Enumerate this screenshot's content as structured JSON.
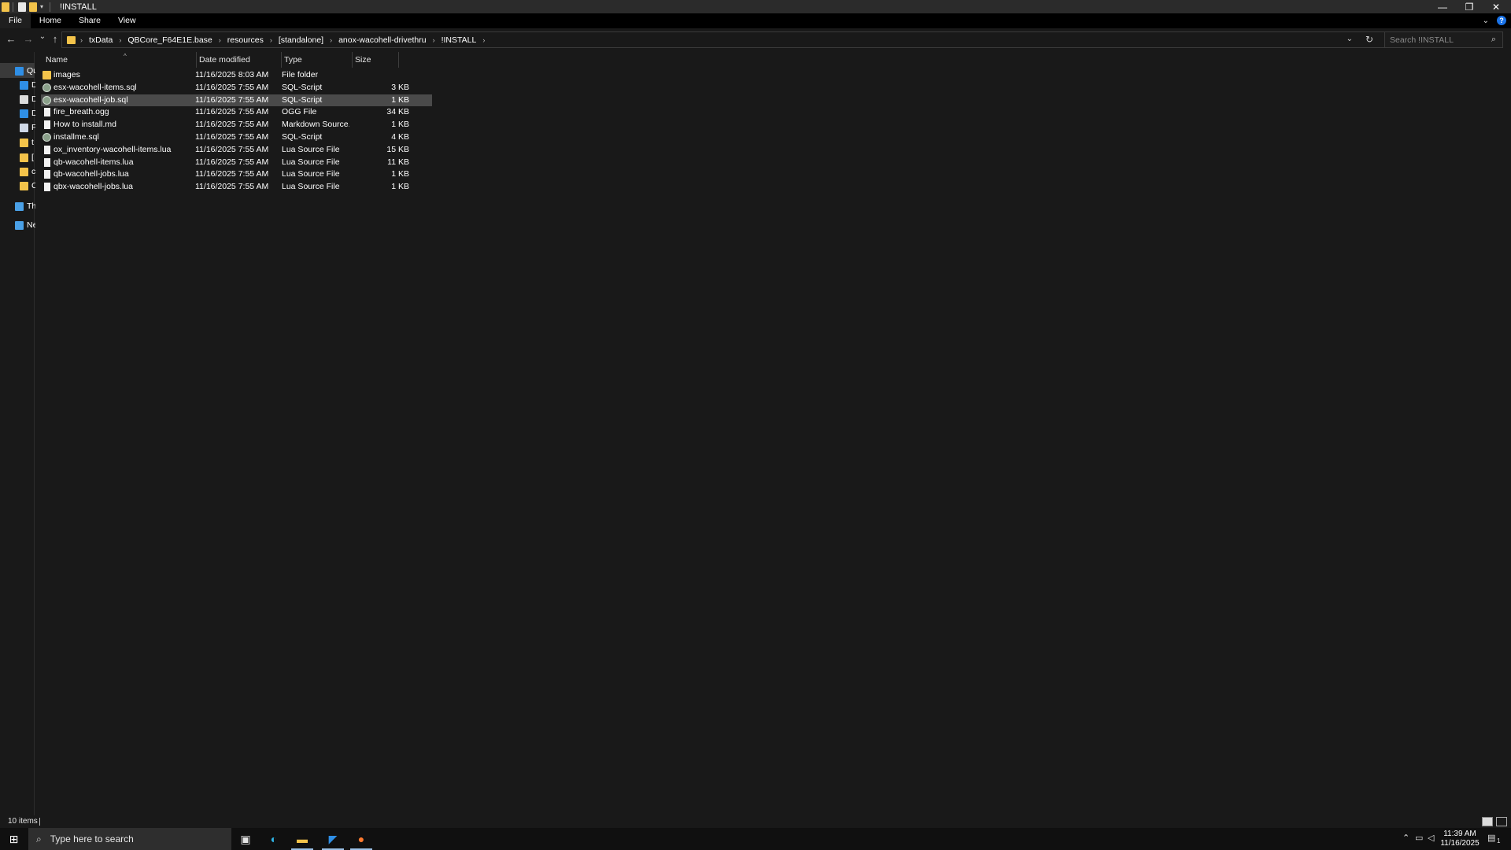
{
  "window": {
    "title": "!INSTALL",
    "controls": {
      "minimize": "—",
      "restore": "❐",
      "close": "✕"
    }
  },
  "ribbon": {
    "tabs": [
      {
        "label": "File"
      },
      {
        "label": "Home"
      },
      {
        "label": "Share"
      },
      {
        "label": "View"
      }
    ]
  },
  "nav_buttons": {
    "back": "←",
    "forward": "→",
    "recent": "⌄",
    "up": "↑"
  },
  "address": {
    "crumbs": [
      {
        "label": "txData"
      },
      {
        "label": "QBCore_F64E1E.base"
      },
      {
        "label": "resources"
      },
      {
        "label": "[standalone]"
      },
      {
        "label": "anox-wacohell-drivethru"
      },
      {
        "label": "!INSTALL"
      }
    ],
    "separator": "›"
  },
  "search": {
    "placeholder": "Search !INSTALL"
  },
  "navpane": {
    "items": [
      {
        "label": "Qu",
        "icon": "quick-access-star-icon",
        "color": "#2f8fe6"
      },
      {
        "label": "D",
        "icon": "desktop-icon",
        "color": "#2f8fe6"
      },
      {
        "label": "D",
        "icon": "documents-icon",
        "color": "#dcdcdc"
      },
      {
        "label": "D",
        "icon": "downloads-icon",
        "color": "#2f8fe6"
      },
      {
        "label": "P",
        "icon": "pictures-icon",
        "color": "#cfd8e6"
      },
      {
        "label": "t",
        "icon": "folder-icon",
        "color": "#f3c34a"
      },
      {
        "label": "[",
        "icon": "folder-icon",
        "color": "#f3c34a"
      },
      {
        "label": "c",
        "icon": "folder-icon",
        "color": "#f3c34a"
      },
      {
        "label": "C",
        "icon": "folder-icon",
        "color": "#f3c34a"
      },
      {
        "label": "Th",
        "icon": "this-pc-icon",
        "color": "#4aa0e6"
      },
      {
        "label": "Ne",
        "icon": "network-icon",
        "color": "#4aa0e6"
      }
    ]
  },
  "columns": {
    "name": "Name",
    "date": "Date modified",
    "type": "Type",
    "size": "Size",
    "sort_indicator": "^"
  },
  "files": [
    {
      "name": "images",
      "date": "11/16/2025 8:03 AM",
      "type": "File folder",
      "size": "",
      "icon": "folder-icon",
      "selected": false
    },
    {
      "name": "esx-wacohell-items.sql",
      "date": "11/16/2025 7:55 AM",
      "type": "SQL-Script",
      "size": "3 KB",
      "icon": "sql-icon",
      "selected": false
    },
    {
      "name": "esx-wacohell-job.sql",
      "date": "11/16/2025 7:55 AM",
      "type": "SQL-Script",
      "size": "1 KB",
      "icon": "sql-icon",
      "selected": true
    },
    {
      "name": "fire_breath.ogg",
      "date": "11/16/2025 7:55 AM",
      "type": "OGG File",
      "size": "34 KB",
      "icon": "file-icon",
      "selected": false
    },
    {
      "name": "How to install.md",
      "date": "11/16/2025 7:55 AM",
      "type": "Markdown Source...",
      "size": "1 KB",
      "icon": "file-icon",
      "selected": false
    },
    {
      "name": "installme.sql",
      "date": "11/16/2025 7:55 AM",
      "type": "SQL-Script",
      "size": "4 KB",
      "icon": "sql-icon",
      "selected": false
    },
    {
      "name": "ox_inventory-wacohell-items.lua",
      "date": "11/16/2025 7:55 AM",
      "type": "Lua Source File",
      "size": "15 KB",
      "icon": "file-icon",
      "selected": false
    },
    {
      "name": "qb-wacohell-items.lua",
      "date": "11/16/2025 7:55 AM",
      "type": "Lua Source File",
      "size": "11 KB",
      "icon": "file-icon",
      "selected": false
    },
    {
      "name": "qb-wacohell-jobs.lua",
      "date": "11/16/2025 7:55 AM",
      "type": "Lua Source File",
      "size": "1 KB",
      "icon": "file-icon",
      "selected": false
    },
    {
      "name": "qbx-wacohell-jobs.lua",
      "date": "11/16/2025 7:55 AM",
      "type": "Lua Source File",
      "size": "1 KB",
      "icon": "file-icon",
      "selected": false
    }
  ],
  "status": {
    "item_count": "10 items"
  },
  "taskbar": {
    "search_placeholder": "Type here to search",
    "apps": [
      {
        "name": "task-view-icon",
        "glyph": "▣",
        "color": "#e6e6e6",
        "active": false
      },
      {
        "name": "edge-icon",
        "glyph": "◐",
        "color": "#2fb6e8",
        "active": false
      },
      {
        "name": "file-explorer-icon",
        "glyph": "▬",
        "color": "#f3c34a",
        "active": true
      },
      {
        "name": "vscode-icon",
        "glyph": "◤",
        "color": "#2f8fe6",
        "active": true
      },
      {
        "name": "firefox-icon",
        "glyph": "●",
        "color": "#ff7a2f",
        "active": true
      }
    ],
    "time": "11:39 AM",
    "date": "11/16/2025",
    "notification_count": "1"
  }
}
